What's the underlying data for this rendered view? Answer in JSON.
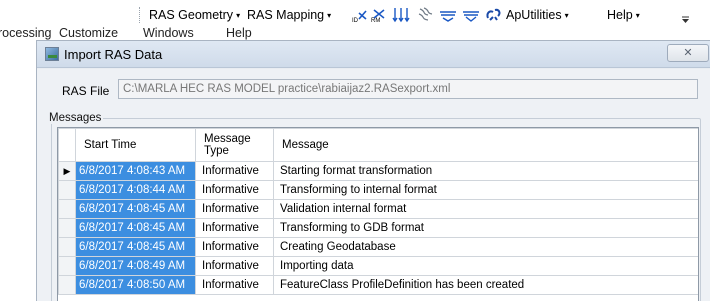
{
  "toolbar": {
    "ras_geometry": "RAS Geometry",
    "ras_mapping": "RAS Mapping",
    "aputilities": "ApUtilities",
    "help": "Help",
    "caret": "▾",
    "icons": [
      "ras-xs-icon",
      "ras-rm-icon",
      "stream-lines-icon",
      "flow-path-icon",
      "bank-lines-icon",
      "levee-icon",
      "storage-area-icon"
    ]
  },
  "menubar": {
    "processing": "rocessing",
    "customize": "Customize",
    "windows": "Windows",
    "help": "Help"
  },
  "dialog": {
    "title": "Import RAS Data",
    "close": "✕",
    "ras_file_label": "RAS File",
    "ras_file_value": "C:\\MARLA HEC RAS MODEL practice\\rabiaijaz2.RASexport.xml",
    "messages_label": "Messages",
    "columns": [
      "Start Time",
      "Message\nType",
      "Message"
    ],
    "rows": [
      {
        "time": "6/8/2017 4:08:43 AM",
        "type": "Informative",
        "message": "Starting format transformation"
      },
      {
        "time": "6/8/2017 4:08:44 AM",
        "type": "Informative",
        "message": "Transforming to internal format"
      },
      {
        "time": "6/8/2017 4:08:45 AM",
        "type": "Informative",
        "message": "Validation internal format"
      },
      {
        "time": "6/8/2017 4:08:45 AM",
        "type": "Informative",
        "message": "Transforming to GDB format"
      },
      {
        "time": "6/8/2017 4:08:45 AM",
        "type": "Informative",
        "message": "Creating Geodatabase"
      },
      {
        "time": "6/8/2017 4:08:49 AM",
        "type": "Informative",
        "message": "Importing data"
      },
      {
        "time": "6/8/2017 4:08:50 AM",
        "type": "Informative",
        "message": "FeatureClass ProfileDefinition has been created"
      }
    ],
    "current_row_marker": "▶"
  }
}
